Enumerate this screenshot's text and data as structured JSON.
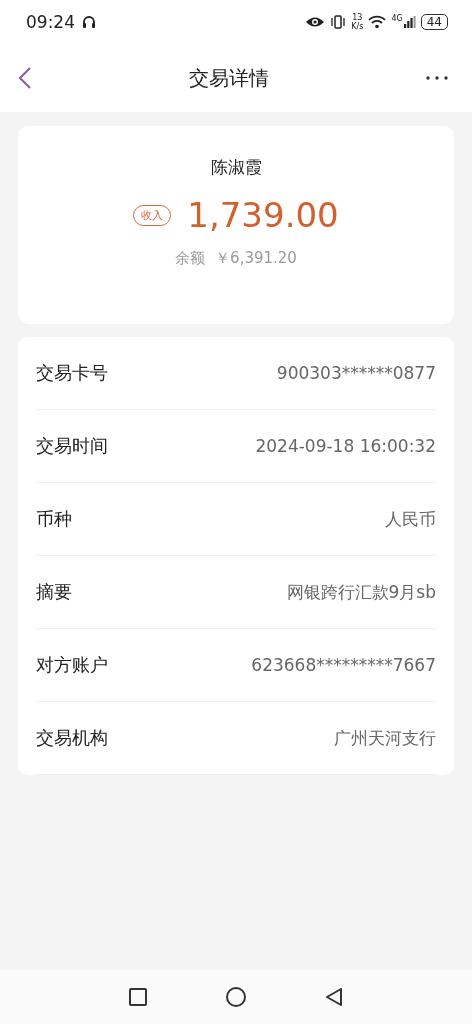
{
  "status_bar": {
    "time": "09:24",
    "speed_value": "13",
    "speed_unit": "K/s",
    "network": "4G",
    "battery": "44"
  },
  "header": {
    "title": "交易详情"
  },
  "summary": {
    "name": "陈淑霞",
    "tag": "收入",
    "amount": "1,739.00",
    "balance_label": "余额",
    "balance": "￥6,391.20"
  },
  "details": [
    {
      "label": "交易卡号",
      "value": "900303******0877"
    },
    {
      "label": "交易时间",
      "value": "2024-09-18 16:00:32"
    },
    {
      "label": "币种",
      "value": "人民币"
    },
    {
      "label": "摘要",
      "value": "网银跨行汇款9月sb"
    },
    {
      "label": "对方账户",
      "value": "623668*********7667"
    },
    {
      "label": "交易机构",
      "value": "广州天河支行"
    }
  ]
}
